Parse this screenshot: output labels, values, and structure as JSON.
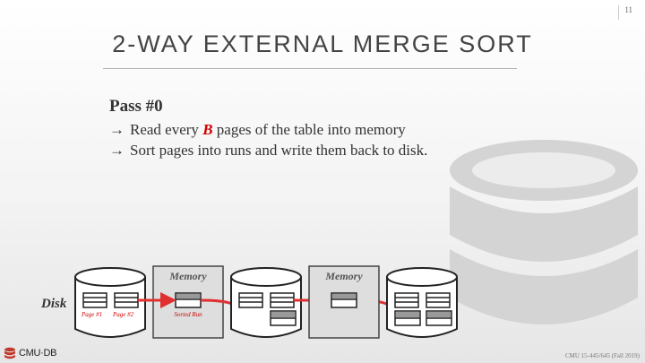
{
  "slide_number": "11",
  "title": "2-WAY EXTERNAL MERGE SORT",
  "pass_heading": "Pass #0",
  "bullets": [
    {
      "arrow": "→",
      "before": "Read every ",
      "highlight": "B",
      "after": " pages of the table into memory"
    },
    {
      "arrow": "→",
      "text": "Sort pages into runs and write them back to disk."
    }
  ],
  "diagram": {
    "disk_label": "Disk",
    "memory_label_1": "Memory",
    "memory_label_2": "Memory",
    "page1_label": "Page #1",
    "page2_label": "Page #2",
    "sorted_run_label": "Sorted Run"
  },
  "logo_text": "CMU·DB",
  "footer": "CMU 15-445/645 (Fall 2019)",
  "colors": {
    "accent": "#d00000",
    "title": "#444444"
  }
}
